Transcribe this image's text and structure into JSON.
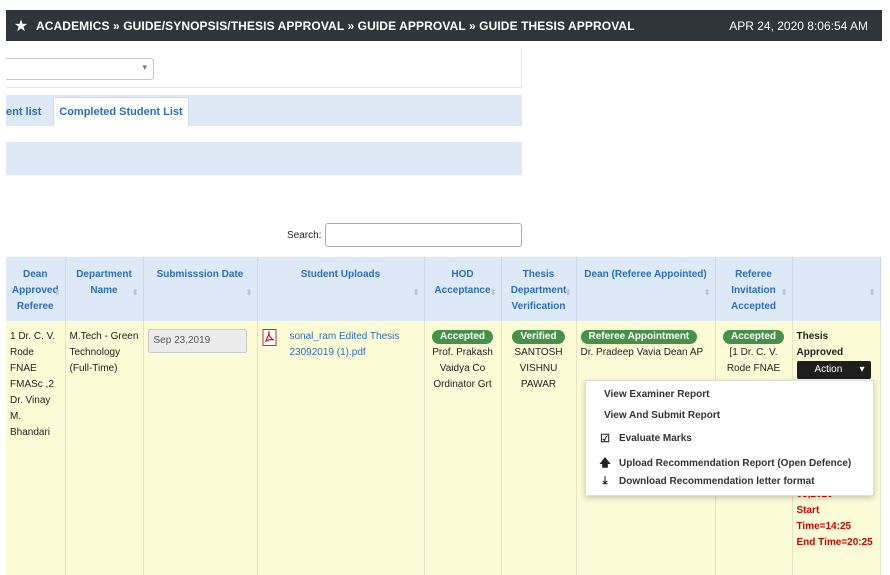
{
  "topbar": {
    "breadcrumb": "ACADEMICS » GUIDE/SYNOPSIS/THESIS APPROVAL » GUIDE APPROVAL » GUIDE THESIS APPROVAL",
    "datetime": "APR 24, 2020  8:06:54 AM",
    "dropdown_glyph": "▾"
  },
  "tabs": [
    "ent list",
    "Completed Student List"
  ],
  "search": {
    "label": "Search:"
  },
  "table": {
    "headers": [
      "Dean Approved Referee",
      "Department Name",
      "Submisssion Date",
      "Student Uploads",
      "HOD Acceptance",
      "Thesis Department Verification",
      "Dean (Referee Appointed)",
      "Referee Invitation Accepted",
      ""
    ],
    "row": {
      "referee": "1 Dr. C. V. Rode FNAE FMASc ,2 Dr. Vinay M. Bhandari",
      "department": "M.Tech - Green Technology (Full-Time)",
      "submission_date": "Sep 23,2019",
      "upload_file": "sonal_ram Edited Thesis 23092019 (1).pdf",
      "hod_badge": "Accepted",
      "hod_name": "Prof. Prakash Vaidya Co Ordinator Grt",
      "verification_badge": "Verified",
      "verification_name": "SANTOSH VISHNU PAWAR",
      "dean_badge": "Referee Appointment",
      "dean_name": "Dr. Pradeep Vavia Dean AP",
      "invitation_badge": "Accepted",
      "invitation_name": "[1 Dr. C. V. Rode FNAE",
      "status": "Thesis Approved",
      "action_label": "Action",
      "schedule_date": "03,2020",
      "start_time": "Start Time=14:25",
      "end_time": "End Time=20:25"
    }
  },
  "dropdown": {
    "items": [
      {
        "label": "View Examiner Report",
        "icon": ""
      },
      {
        "label": "View And Submit Report",
        "icon": ""
      },
      {
        "label": "Evaluate Marks",
        "icon": "checkbox-icon"
      },
      {
        "label": "Upload Recommendation Report (Open Defence)",
        "icon": "arrow-up-icon"
      },
      {
        "label": "Download Recommendation letter format",
        "icon": "download-icon"
      }
    ]
  },
  "colors": {
    "topbar": "#2f353b",
    "header": "#dde9f7",
    "row": "#fbfbd5",
    "badge": "#45914a",
    "link": "#2a6ebb",
    "red": "#cc0000"
  }
}
